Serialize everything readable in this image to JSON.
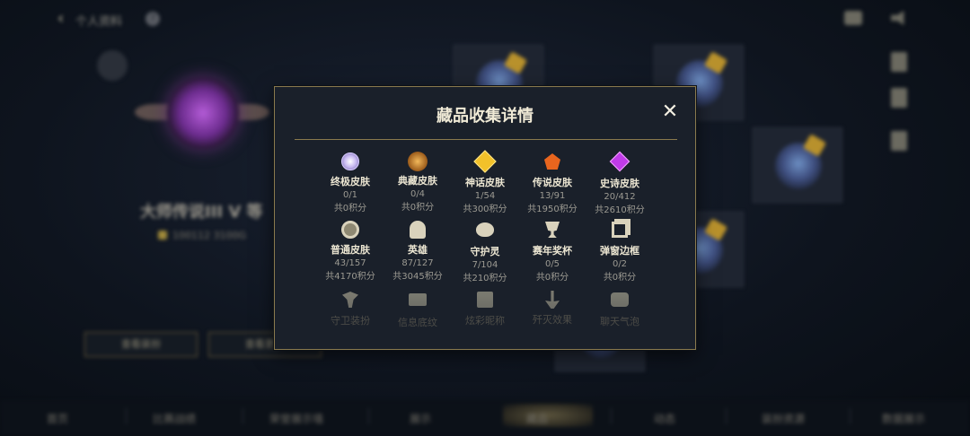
{
  "background": {
    "page_title": "个人资料",
    "rank_text": "大师传说III V 等",
    "points_text": "100112 3100G",
    "buttons": [
      "查看装扮",
      "查看更多"
    ],
    "bottom_tabs": [
      "首页",
      "比赛战绩",
      "荣誉展示墙",
      "展示",
      "藏品",
      "动态",
      "装扮资源",
      "数据展示"
    ]
  },
  "modal": {
    "title": "藏品收集详情",
    "close_label": "✕",
    "items": [
      {
        "label": "终极皮肤",
        "count": "0/1",
        "points": "共0积分",
        "icon": "ultimate-skin-icon"
      },
      {
        "label": "典藏皮肤",
        "count": "0/4",
        "points": "共0积分",
        "icon": "collection-skin-icon"
      },
      {
        "label": "神话皮肤",
        "count": "1/54",
        "points": "共300积分",
        "icon": "mythic-skin-icon"
      },
      {
        "label": "传说皮肤",
        "count": "13/91",
        "points": "共1950积分",
        "icon": "legendary-skin-icon"
      },
      {
        "label": "史诗皮肤",
        "count": "20/412",
        "points": "共2610积分",
        "icon": "epic-skin-icon"
      },
      {
        "label": "普通皮肤",
        "count": "43/157",
        "points": "共4170积分",
        "icon": "normal-skin-icon"
      },
      {
        "label": "英雄",
        "count": "87/127",
        "points": "共3045积分",
        "icon": "hero-helmet-icon"
      },
      {
        "label": "守护灵",
        "count": "7/104",
        "points": "共210积分",
        "icon": "guardian-spirit-icon"
      },
      {
        "label": "赛年奖杯",
        "count": "0/5",
        "points": "共0积分",
        "icon": "season-trophy-icon"
      },
      {
        "label": "弹窗边框",
        "count": "0/2",
        "points": "共0积分",
        "icon": "popup-frame-icon"
      },
      {
        "label": "守卫装扮",
        "icon": "ward-skin-icon"
      },
      {
        "label": "信息底纹",
        "icon": "info-card-icon"
      },
      {
        "label": "炫彩昵称",
        "icon": "colorful-name-icon"
      },
      {
        "label": "歼灭效果",
        "icon": "annihilation-effect-icon"
      },
      {
        "label": "聊天气泡",
        "icon": "chat-bubble-icon"
      }
    ]
  }
}
